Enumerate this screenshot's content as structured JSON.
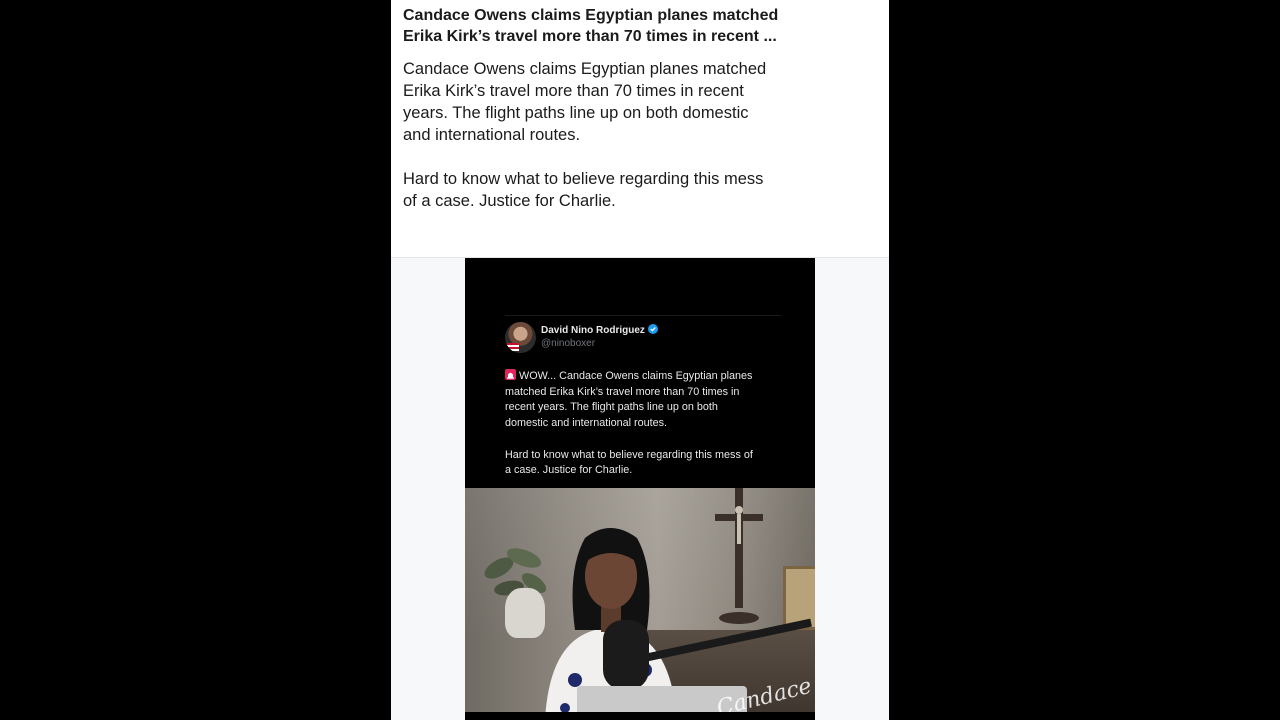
{
  "post": {
    "title": "Candace Owens claims Egyptian planes matched\nErika Kirk’s travel more than 70 times in recent ...",
    "body": "Candace Owens claims Egyptian planes matched\nErika Kirk’s travel more than 70 times in recent\nyears. The flight paths line up on both domestic\nand international routes.\n\nHard to know what to believe regarding this mess\nof a case. Justice for Charlie."
  },
  "tweet": {
    "author_name": "David Nino Rodriguez",
    "author_handle": "@ninoboxer",
    "verified_icon": "verified-badge-icon",
    "siren_icon": "siren-icon",
    "text": "WOW... Candace Owens claims Egyptian planes\nmatched Erika Kirk’s travel more than 70 times in\nrecent years. The flight paths line up on both\ndomestic and international routes.\n\nHard to know what to believe regarding this mess of\na case. Justice for Charlie."
  },
  "video": {
    "watermark": "Candace"
  },
  "colors": {
    "page_background": "#000000",
    "post_background": "#ffffff",
    "tweet_background": "#000000",
    "tweet_text": "#e7e9ea",
    "handle_text": "#71767b",
    "verified_blue": "#1d9bf0",
    "siren_red": "#e0245e"
  }
}
